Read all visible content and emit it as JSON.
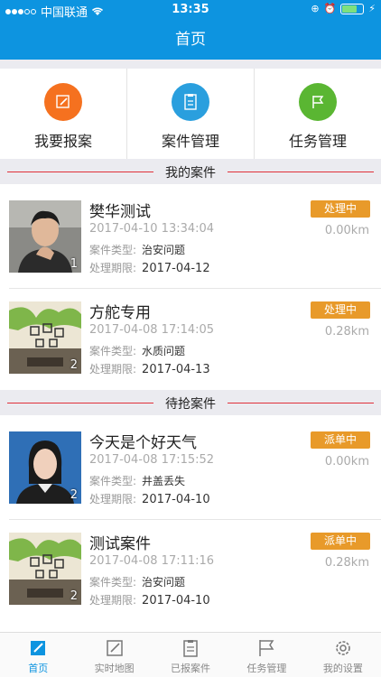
{
  "status": {
    "carrier": "中国联通",
    "time": "13:35"
  },
  "nav": {
    "title": "首页"
  },
  "quick_actions": [
    {
      "label": "我要报案",
      "icon": "edit-icon",
      "color": "#f5711f"
    },
    {
      "label": "案件管理",
      "icon": "clipboard-icon",
      "color": "#2a9fde"
    },
    {
      "label": "任务管理",
      "icon": "flag-icon",
      "color": "#5ab632"
    }
  ],
  "sections": {
    "my_cases": "我的案件",
    "pending_cases": "待抢案件"
  },
  "my_cases": [
    {
      "name": "樊华测试",
      "time": "2017-04-10 13:34:04",
      "type_label": "案件类型:",
      "type": "治安问题",
      "deadline_label": "处理期限:",
      "deadline": "2017-04-12",
      "status": "处理中",
      "distance": "0.00km",
      "count": "1"
    },
    {
      "name": "方舵专用",
      "time": "2017-04-08 17:14:05",
      "type_label": "案件类型:",
      "type": "水质问题",
      "deadline_label": "处理期限:",
      "deadline": "2017-04-13",
      "status": "处理中",
      "distance": "0.28km",
      "count": "2"
    }
  ],
  "pending_cases": [
    {
      "name": "今天是个好天气",
      "time": "2017-04-08 17:15:52",
      "type_label": "案件类型:",
      "type": "井盖丢失",
      "deadline_label": "处理期限:",
      "deadline": "2017-04-10",
      "status": "派单中",
      "distance": "0.00km",
      "count": "2"
    },
    {
      "name": "测试案件",
      "time": "2017-04-08 17:11:16",
      "type_label": "案件类型:",
      "type": "治安问题",
      "deadline_label": "处理期限:",
      "deadline": "2017-04-10",
      "status": "派单中",
      "distance": "0.28km",
      "count": "2"
    }
  ],
  "tabs": [
    {
      "label": "首页",
      "icon": "home-edit-icon",
      "active": true
    },
    {
      "label": "实时地图",
      "icon": "map-edit-icon",
      "active": false
    },
    {
      "label": "已报案件",
      "icon": "clipboard-icon",
      "active": false
    },
    {
      "label": "任务管理",
      "icon": "flag-icon",
      "active": false
    },
    {
      "label": "我的设置",
      "icon": "gear-icon",
      "active": false
    }
  ],
  "colors": {
    "primary": "#0d94e0",
    "badge": "#e89a2a",
    "section_line": "#e0303a"
  }
}
